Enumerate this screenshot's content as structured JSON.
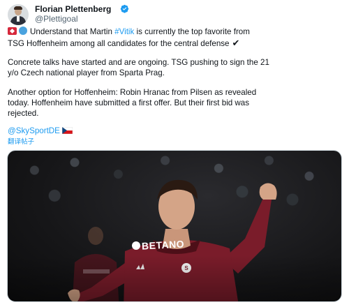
{
  "author": {
    "display_name": "Florian Plettenberg",
    "handle": "@Plettigoal",
    "verified": true,
    "avatar_icon": "profile-photo"
  },
  "tweet": {
    "line1_pre": "Understand that Martin ",
    "line1_hashtag": "#Vitik",
    "line1_post": " is currently the top favorite from",
    "line2": "TSG Hoffenheim among all candidates for the central defense",
    "line2_icon": "heavy-check-mark",
    "line3": "Concrete talks have started and are ongoing. TSG pushing to sign the 21",
    "line4": "y/o Czech national player from Sparta Prag.",
    "line5": "Another option for Hoffenheim: Robin Hranac from Pilsen as revealed",
    "line6": "today. Hoffenheim have submitted a first offer. But their first bid was",
    "line7": "rejected.",
    "mention": "@SkySportDE",
    "mention_flag": "czech-flag",
    "translate_link": "翻译帖子",
    "lead_icons": [
      "tsg-flag-icon",
      "blue-circle-icon"
    ]
  },
  "media": {
    "sponsor_text": "BETANO",
    "jersey_color": "#7a1c2a",
    "accent_color": "#1d9bf0"
  }
}
